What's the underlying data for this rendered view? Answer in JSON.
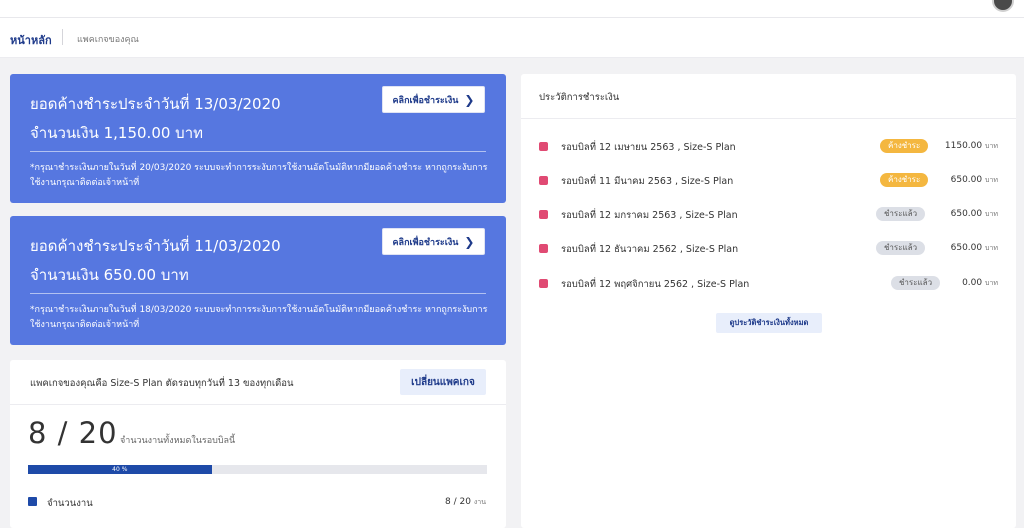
{
  "breadcrumb": {
    "home": "หน้าหลัก",
    "current": "แพคเกจของคุณ"
  },
  "due_cards": [
    {
      "title": "ยอดค้างชำระประจำวันที่ 13/03/2020",
      "amount": "จำนวนเงิน 1,150.00 บาท",
      "button": "คลิกเพื่อชำระเงิน",
      "note": "*กรุณาชำระเงินภายในวันที่ 20/03/2020 ระบบจะทำการระงับการใช้งานอัตโนมัติหากมียอดค้างชำระ หากถูกระงับการใช้งานกรุณาติดต่อเจ้าหน้าที่"
    },
    {
      "title": "ยอดค้างชำระประจำวันที่ 11/03/2020",
      "amount": "จำนวนเงิน 650.00 บาท",
      "button": "คลิกเพื่อชำระเงิน",
      "note": "*กรุณาชำระเงินภายในวันที่ 18/03/2020 ระบบจะทำการระงับการใช้งานอัตโนมัติหากมียอดค้างชำระ หากถูกระงับการใช้งานกรุณาติดต่อเจ้าหน้าที่"
    }
  ],
  "package": {
    "title": "แพคเกจของคุณคือ Size-S Plan ตัดรอบทุกวันที่ 13 ของทุกเดือน",
    "change_button": "เปลี่ยนแพคเกจ",
    "count_text": "8 / 20",
    "count_caption": "จำนวนงานทั้งหมดในรอบบิลนี้",
    "progress_percent": 40,
    "progress_label": "40 %",
    "legend_label": "จำนวนงาน",
    "legend_value": "8 / 20",
    "legend_unit": "งาน"
  },
  "history": {
    "title": "ประวัติการชำระเงิน",
    "view_all_button": "ดูประวัติชำระเงินทั้งหมด",
    "rows": [
      {
        "label": "รอบบิลที่ 12 เมษายน 2563 , Size-S Plan",
        "status": "ค้างชำระ",
        "status_type": "due",
        "amount": "1150.00",
        "unit": "บาท"
      },
      {
        "label": "รอบบิลที่ 11 มีนาคม 2563 , Size-S Plan",
        "status": "ค้างชำระ",
        "status_type": "due",
        "amount": "650.00",
        "unit": "บาท"
      },
      {
        "label": "รอบบิลที่ 12 มกราคม 2563 , Size-S Plan",
        "status": "ชำระแล้ว",
        "status_type": "paid",
        "amount": "650.00",
        "unit": "บาท"
      },
      {
        "label": "รอบบิลที่ 12 ธันวาคม 2562 , Size-S Plan",
        "status": "ชำระแล้ว",
        "status_type": "paid",
        "amount": "650.00",
        "unit": "บาท"
      },
      {
        "label": "รอบบิลที่ 12 พฤศจิกายน 2562 , Size-S Plan",
        "status": "ชำระแล้ว",
        "status_type": "paid",
        "amount": "0.00",
        "unit": "บาท"
      }
    ]
  },
  "colors": {
    "primary": "#5677e0",
    "navy": "#1e3a8a",
    "due_badge": "#f4b740",
    "dot": "#e04a73"
  }
}
